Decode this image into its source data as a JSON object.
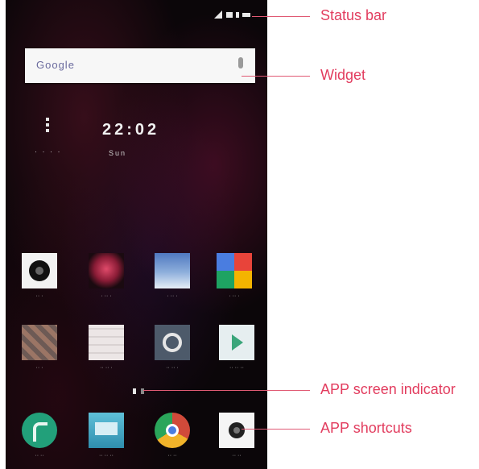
{
  "callouts": {
    "status_bar": "Status bar",
    "widget": "Widget",
    "app_screen_indicator": "APP screen indicator",
    "app_shortcuts": "APP shortcuts"
  },
  "widget": {
    "logo_text": "Google",
    "mic_icon": "microphone-icon"
  },
  "clock": {
    "time": "22:02",
    "date": "Sun"
  },
  "weather": {
    "icon": "weather-icon"
  },
  "apps": {
    "row1": [
      {
        "icon": "camera-app-icon",
        "color": "#f2f2f2"
      },
      {
        "icon": "music-app-icon",
        "color": "#a8314d"
      },
      {
        "icon": "gallery-app-icon",
        "color": "#6a8cc6"
      },
      {
        "icon": "photos-app-icon",
        "color": "#f0b030"
      }
    ],
    "row2": [
      {
        "icon": "tools-folder-icon",
        "color": "#8c6a5a"
      },
      {
        "icon": "google-folder-icon",
        "color": "#e9e4e4"
      },
      {
        "icon": "settings-app-icon",
        "color": "#4d5a6a"
      },
      {
        "icon": "play-store-app-icon",
        "color": "#e6eef0"
      }
    ],
    "dock": [
      {
        "icon": "phone-app-icon",
        "color": "#22a07a"
      },
      {
        "icon": "messaging-app-icon",
        "color": "#46a9c6"
      },
      {
        "icon": "chrome-app-icon",
        "color": "#d04a3a"
      },
      {
        "icon": "camera-shortcut-icon",
        "color": "#f5f5f5"
      }
    ]
  }
}
